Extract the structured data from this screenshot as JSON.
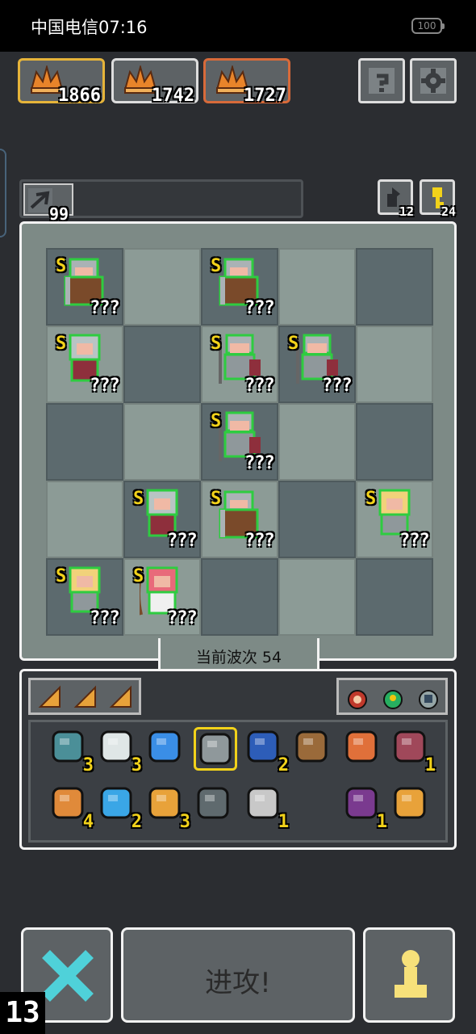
{
  "status_bar": {
    "carrier_time": "中国电信07:16",
    "battery": "100"
  },
  "resources": [
    {
      "name": "crown-gold",
      "value": "1866",
      "frame": "#e6b43a"
    },
    {
      "name": "crown-silver",
      "value": "1742",
      "frame": "#dddddd"
    },
    {
      "name": "crown-bronze",
      "value": "1727",
      "frame": "#d86a3a"
    }
  ],
  "top_buttons": {
    "help_icon": "question-mark-icon",
    "settings_icon": "gear-icon"
  },
  "spell": {
    "count": "99"
  },
  "counters": {
    "refresh": "12",
    "key": "24"
  },
  "board": {
    "units": [
      {
        "grade": "S",
        "level": "???"
      },
      {
        "grade": "S",
        "level": "???"
      },
      {
        "grade": "S",
        "level": "???"
      },
      {
        "grade": "S",
        "level": "???"
      },
      {
        "grade": "S",
        "level": "???"
      },
      {
        "grade": "S",
        "level": "???"
      },
      {
        "grade": "S",
        "level": "???"
      },
      {
        "grade": "S",
        "level": "???"
      },
      {
        "grade": "S",
        "level": "???"
      },
      {
        "grade": "S",
        "level": "???"
      },
      {
        "grade": "S",
        "level": "???"
      }
    ],
    "wave_label": "当前波次 54"
  },
  "inventory": {
    "items_row1": [
      {
        "icon": "heart-shield-icon",
        "count": "3"
      },
      {
        "icon": "scroll-icon",
        "count": "3"
      },
      {
        "icon": "lightning-icon",
        "count": ""
      },
      {
        "icon": "crown-icon",
        "count": ""
      },
      {
        "icon": "hourglass-icon",
        "count": "2"
      },
      {
        "icon": "feather-icon",
        "count": ""
      },
      {
        "icon": "treasure-chest-icon",
        "count": ""
      },
      {
        "icon": "armor-icon",
        "count": "1"
      }
    ],
    "items_row2": [
      {
        "icon": "horn-icon",
        "count": "4"
      },
      {
        "icon": "blue-orb-icon",
        "count": "2"
      },
      {
        "icon": "eye-icon",
        "count": "3"
      },
      {
        "icon": "monster-mask-icon",
        "count": ""
      },
      {
        "icon": "lantern-icon",
        "count": "1"
      },
      {
        "icon": "demon-icon",
        "count": "1"
      },
      {
        "icon": "key-icon",
        "count": ""
      }
    ]
  },
  "actions": {
    "cancel_icon": "cross-icon",
    "attack_label": "进攻!",
    "pawn_icon": "pawn-icon"
  },
  "corner_badge": "13",
  "colors": {
    "accent_gold": "#f2d21a",
    "green_outline": "#2ecc40",
    "frame": "#f2f2f2"
  }
}
